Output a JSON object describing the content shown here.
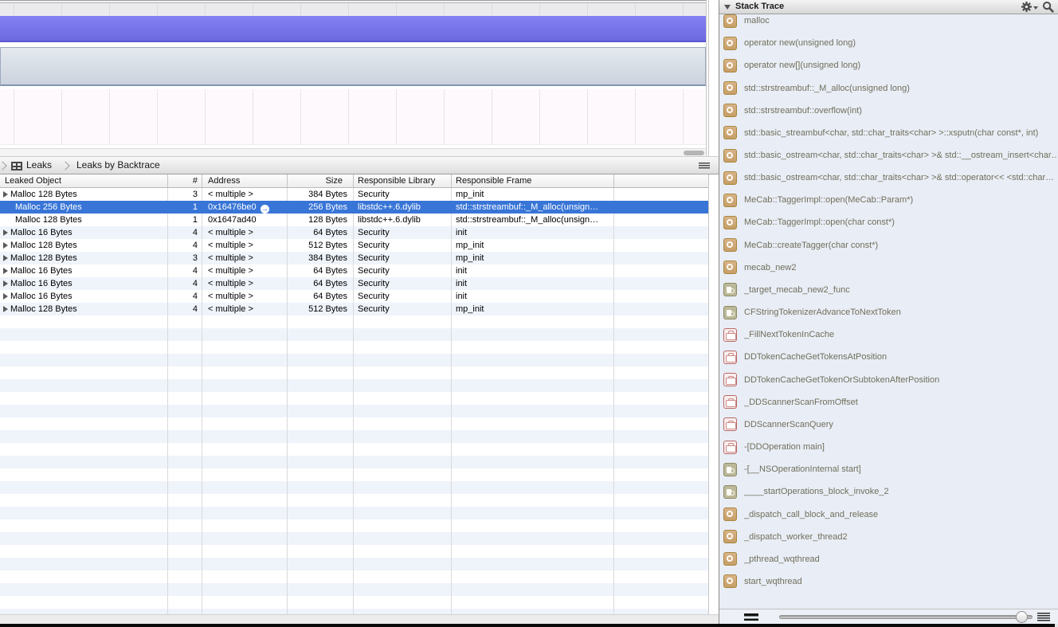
{
  "breadcrumb": {
    "items": [
      "Leaks",
      "Leaks by Backtrace"
    ]
  },
  "table": {
    "columns": [
      "Leaked Object",
      "#",
      "Address",
      "Size",
      "Responsible Library",
      "Responsible Frame"
    ],
    "rows": [
      {
        "state": "normal",
        "object": "Malloc 128 Bytes",
        "count": "3",
        "address": "< multiple >",
        "size": "384 Bytes",
        "library": "Security",
        "frame": "mp_init"
      },
      {
        "state": "selected",
        "object": "Malloc 256 Bytes",
        "count": "1",
        "address": "0x16476be0",
        "size": "256 Bytes",
        "library": "libstdc++.6.dylib",
        "frame": "std::strstreambuf::_M_alloc(unsign…"
      },
      {
        "state": "normal",
        "object": "Malloc 128 Bytes",
        "count": "1",
        "address": "0x1647ad40",
        "size": "128 Bytes",
        "library": "libstdc++.6.dylib",
        "frame": "std::strstreambuf::_M_alloc(unsign…"
      },
      {
        "state": "normal",
        "object": "Malloc 16 Bytes",
        "count": "4",
        "address": "< multiple >",
        "size": "64 Bytes",
        "library": "Security",
        "frame": "init"
      },
      {
        "state": "normal",
        "object": "Malloc 128 Bytes",
        "count": "4",
        "address": "< multiple >",
        "size": "512 Bytes",
        "library": "Security",
        "frame": "mp_init"
      },
      {
        "state": "normal",
        "object": "Malloc 128 Bytes",
        "count": "3",
        "address": "< multiple >",
        "size": "384 Bytes",
        "library": "Security",
        "frame": "mp_init"
      },
      {
        "state": "normal",
        "object": "Malloc 16 Bytes",
        "count": "4",
        "address": "< multiple >",
        "size": "64 Bytes",
        "library": "Security",
        "frame": "init"
      },
      {
        "state": "normal",
        "object": "Malloc 16 Bytes",
        "count": "4",
        "address": "< multiple >",
        "size": "64 Bytes",
        "library": "Security",
        "frame": "init"
      },
      {
        "state": "normal",
        "object": "Malloc 16 Bytes",
        "count": "4",
        "address": "< multiple >",
        "size": "64 Bytes",
        "library": "Security",
        "frame": "init"
      },
      {
        "state": "normal",
        "object": "Malloc 128 Bytes",
        "count": "4",
        "address": "< multiple >",
        "size": "512 Bytes",
        "library": "Security",
        "frame": "mp_init"
      }
    ]
  },
  "stack_trace": {
    "title": "Stack Trace",
    "frames": [
      {
        "label": "malloc",
        "icon": "tan-gear"
      },
      {
        "label": "operator new(unsigned long)",
        "icon": "tan-gear"
      },
      {
        "label": "operator new[](unsigned long)",
        "icon": "tan-gear"
      },
      {
        "label": "std::strstreambuf::_M_alloc(unsigned long)",
        "icon": "tan-gear"
      },
      {
        "label": "std::strstreambuf::overflow(int)",
        "icon": "tan-gear"
      },
      {
        "label": "std::basic_streambuf<char, std::char_traits<char> >::xsputn(char const*, int)",
        "icon": "tan-gear"
      },
      {
        "label": "std::basic_ostream<char, std::char_traits<char> >& std::__ostream_insert<char…",
        "icon": "tan-gear"
      },
      {
        "label": "std::basic_ostream<char, std::char_traits<char> >& std::operator<< <std::char…",
        "icon": "tan-gear"
      },
      {
        "label": "MeCab::TaggerImpl::open(MeCab::Param*)",
        "icon": "tan-gear"
      },
      {
        "label": "MeCab::TaggerImpl::open(char const*)",
        "icon": "tan-gear"
      },
      {
        "label": "MeCab::createTagger(char const*)",
        "icon": "tan-gear"
      },
      {
        "label": "mecab_new2",
        "icon": "tan-gear"
      },
      {
        "label": "_target_mecab_new2_func",
        "icon": "mug"
      },
      {
        "label": "CFStringTokenizerAdvanceToNextToken",
        "icon": "mug"
      },
      {
        "label": "_FillNextTokenInCache",
        "icon": "red-case"
      },
      {
        "label": "DDTokenCacheGetTokensAtPosition",
        "icon": "red-case"
      },
      {
        "label": "DDTokenCacheGetTokenOrSubtokenAfterPosition",
        "icon": "red-case"
      },
      {
        "label": "_DDScannerScanFromOffset",
        "icon": "red-case"
      },
      {
        "label": "DDScannerScanQuery",
        "icon": "red-case"
      },
      {
        "label": "-[DDOperation main]",
        "icon": "red-case"
      },
      {
        "label": "-[__NSOperationInternal start]",
        "icon": "mug"
      },
      {
        "label": "____startOperations_block_invoke_2",
        "icon": "mug"
      },
      {
        "label": "_dispatch_call_block_and_release",
        "icon": "tan-gear"
      },
      {
        "label": "_dispatch_worker_thread2",
        "icon": "tan-gear"
      },
      {
        "label": "_pthread_wqthread",
        "icon": "tan-gear"
      },
      {
        "label": "start_wqthread",
        "icon": "tan-gear"
      }
    ]
  },
  "colors": {
    "selection_blue": "#3875d7",
    "track_purple": "#7673ea",
    "track_panel_blue_gray": "#d3dae3",
    "stack_panel_bg": "#e9edf5"
  }
}
